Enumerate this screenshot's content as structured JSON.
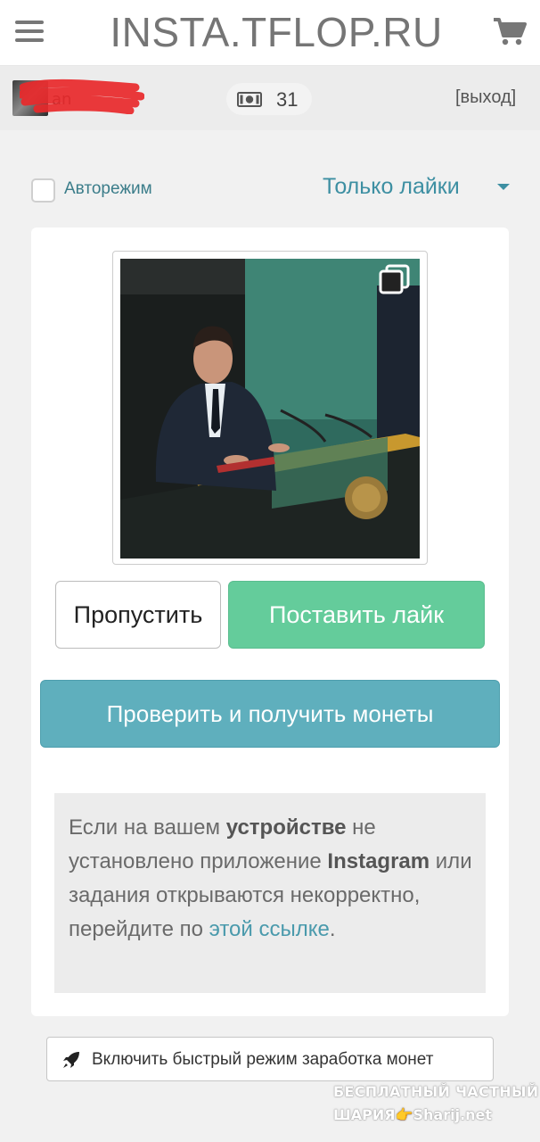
{
  "header": {
    "site_title": "INSTA.TFLOP.RU",
    "menu_icon": "hamburger-menu-icon",
    "cart_icon": "shopping-cart-icon"
  },
  "userbar": {
    "username": "an",
    "coins": "31",
    "coin_icon": "money-bill-icon",
    "logout_label": "[выход]"
  },
  "controls": {
    "auto_mode_label": "Авторежим",
    "auto_mode_checked": false,
    "mode_selected": "Только лайки"
  },
  "post": {
    "multi_image_icon": "multiple-images-icon"
  },
  "actions": {
    "skip_label": "Пропустить",
    "like_label": "Поставить лайк",
    "check_label": "Проверить и получить монеты"
  },
  "notice": {
    "part1": "Если на вашем ",
    "bold1": "устройстве",
    "part2": " не установлено приложение ",
    "bold2": "Instagram",
    "part3": " или задания открываются некорректно, перейдите по ",
    "link_text": "этой ссылке",
    "part4": "."
  },
  "fast_mode": {
    "label": "Включить быстрый режим заработка монет",
    "icon": "rocket-icon"
  },
  "watermark": {
    "line1": "БЕСПЛАТНЫЙ ЧАСТНЫЙ",
    "line2": "ШАРИЯ👉Sharij.net"
  },
  "colors": {
    "accent_green": "#64cc9b",
    "accent_teal": "#5fafbd",
    "link": "#4a9aac"
  }
}
